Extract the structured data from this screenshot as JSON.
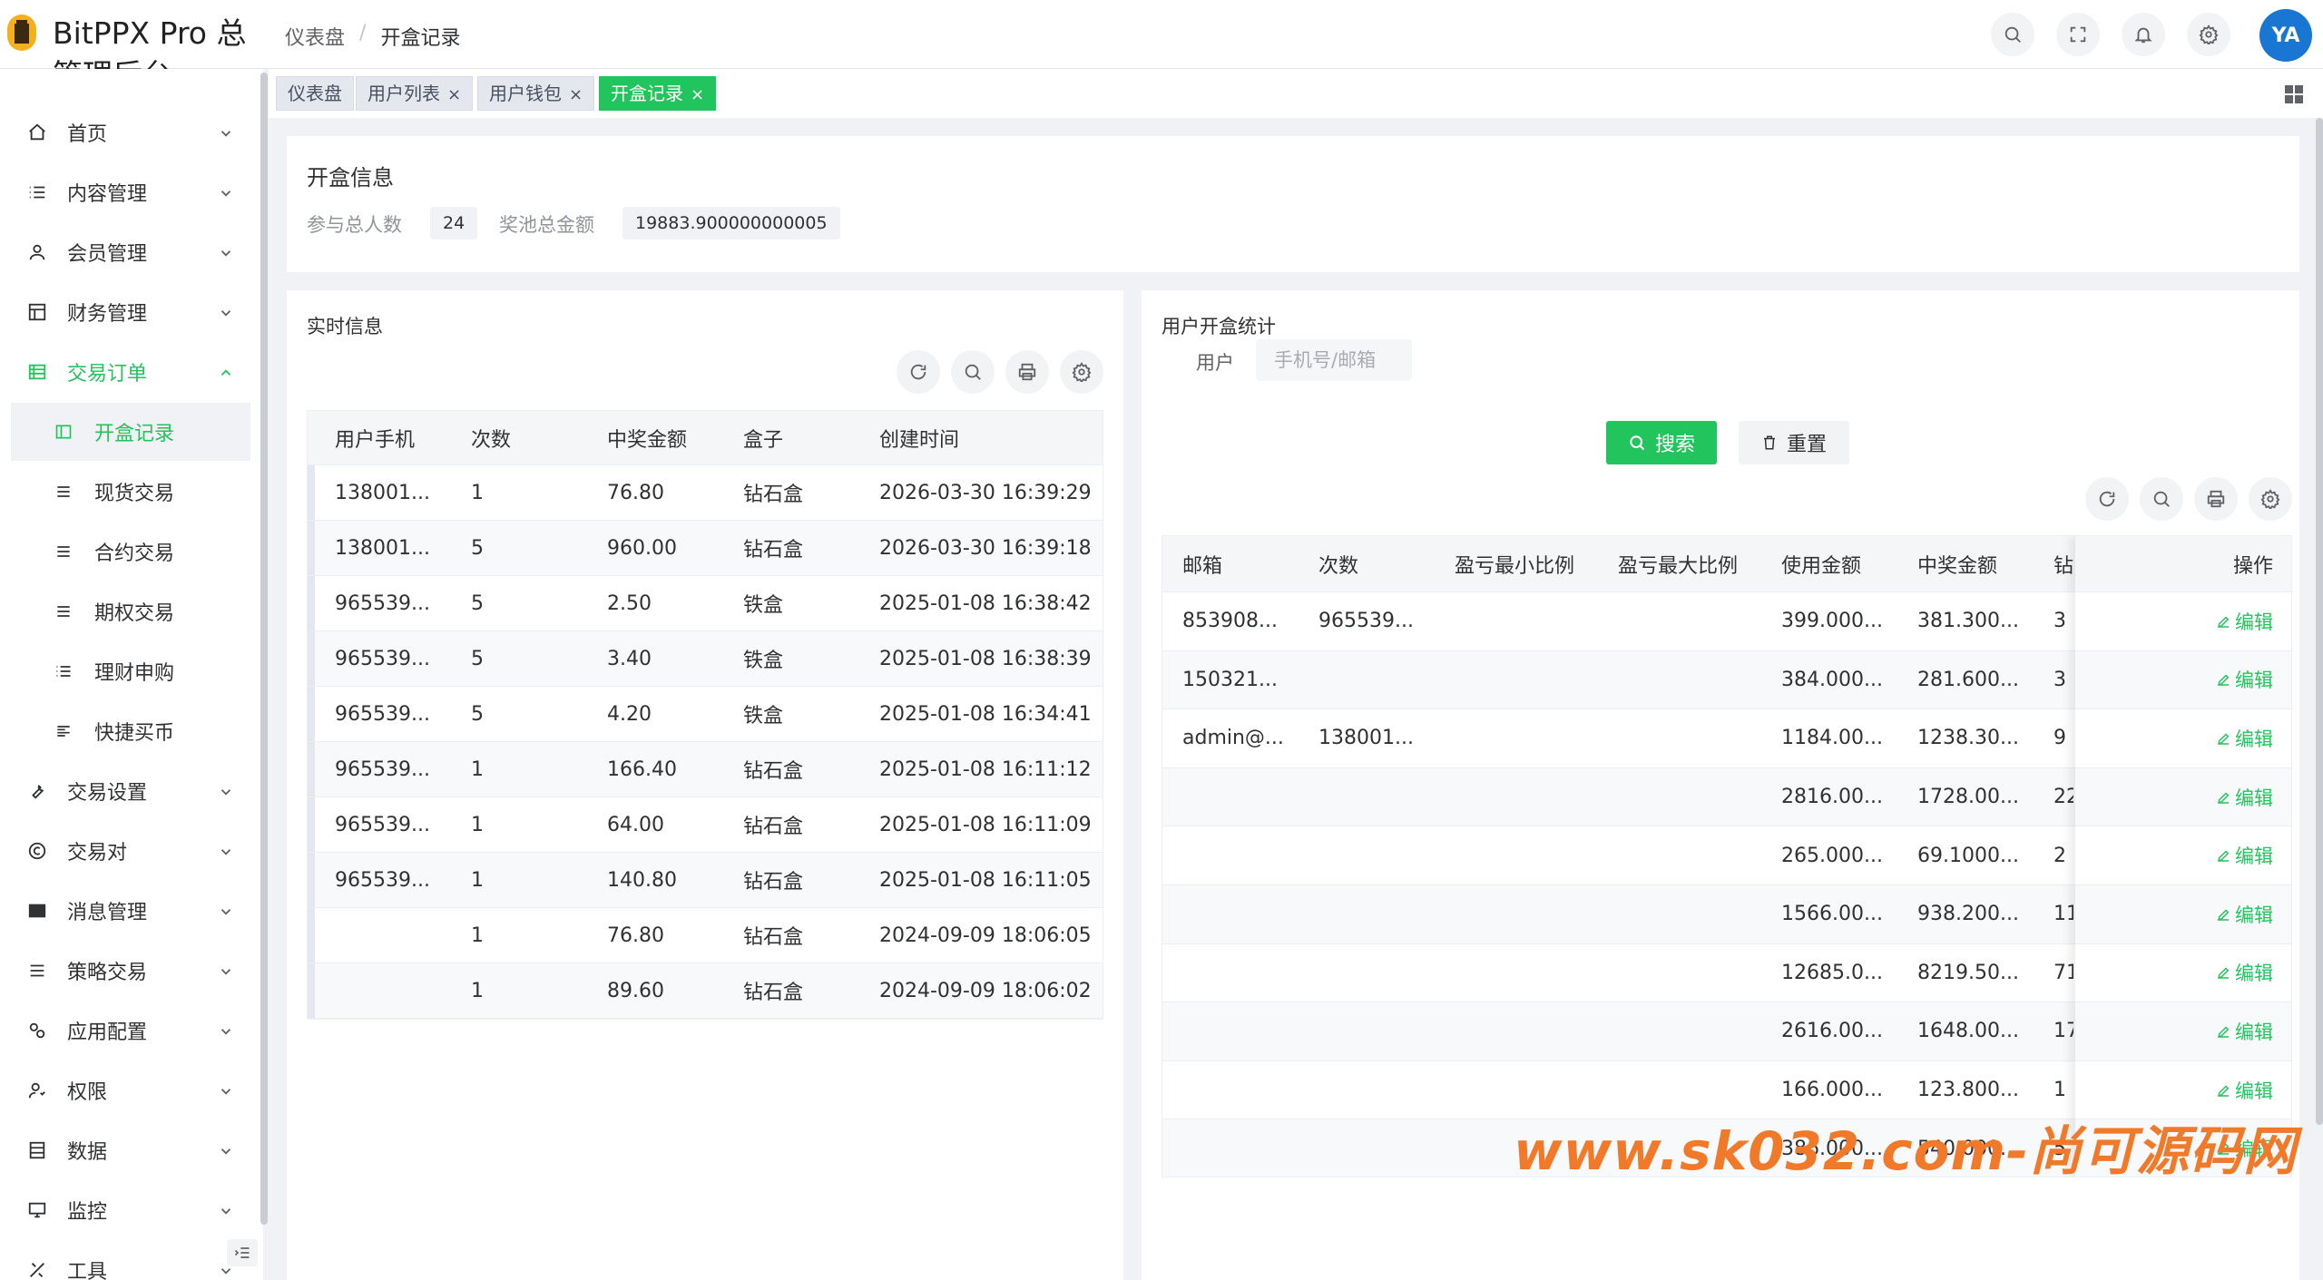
{
  "header": {
    "app_title": "BitPPX Pro 总管理后台",
    "breadcrumb": [
      "仪表盘",
      "开盒记录"
    ],
    "breadcrumb_sep": "/",
    "avatar_text": "YA"
  },
  "sidebar": {
    "menus": [
      {
        "label": "首页",
        "icon": "home-icon"
      },
      {
        "label": "内容管理",
        "icon": "list-icon"
      },
      {
        "label": "会员管理",
        "icon": "user-icon"
      },
      {
        "label": "财务管理",
        "icon": "table-icon"
      },
      {
        "label": "交易订单",
        "icon": "order-icon",
        "expanded": true
      },
      {
        "label": "交易设置",
        "icon": "wrench-icon"
      },
      {
        "label": "交易对",
        "icon": "copyright-icon"
      },
      {
        "label": "消息管理",
        "icon": "message-icon"
      },
      {
        "label": "策略交易",
        "icon": "menu-icon"
      },
      {
        "label": "应用配置",
        "icon": "config-icon"
      },
      {
        "label": "权限",
        "icon": "permission-icon"
      },
      {
        "label": "数据",
        "icon": "database-icon"
      },
      {
        "label": "监控",
        "icon": "monitor-icon"
      },
      {
        "label": "工具",
        "icon": "tool-icon"
      }
    ],
    "submenus": [
      {
        "label": "开盒记录",
        "active": true
      },
      {
        "label": "现货交易"
      },
      {
        "label": "合约交易"
      },
      {
        "label": "期权交易"
      },
      {
        "label": "理财申购"
      },
      {
        "label": "快捷买币"
      }
    ]
  },
  "tabs": [
    {
      "label": "仪表盘",
      "closable": false
    },
    {
      "label": "用户列表",
      "closable": true
    },
    {
      "label": "用户钱包",
      "closable": true
    },
    {
      "label": "开盒记录",
      "closable": true,
      "active": true
    }
  ],
  "tab_close_glyph": "×",
  "summary": {
    "title": "开盒信息",
    "participants_label": "参与总人数",
    "participants_value": "24",
    "pool_label": "奖池总金额",
    "pool_value": "19883.900000000005"
  },
  "realtime": {
    "title": "实时信息",
    "columns": [
      "用户手机",
      "次数",
      "中奖金额",
      "盒子",
      "创建时间"
    ],
    "rows": [
      [
        "138001...",
        "1",
        "76.80",
        "钻石盒",
        "2026-03-30 16:39:29"
      ],
      [
        "138001...",
        "5",
        "960.00",
        "钻石盒",
        "2026-03-30 16:39:18"
      ],
      [
        "965539...",
        "5",
        "2.50",
        "铁盒",
        "2025-01-08 16:38:42"
      ],
      [
        "965539...",
        "5",
        "3.40",
        "铁盒",
        "2025-01-08 16:38:39"
      ],
      [
        "965539...",
        "5",
        "4.20",
        "铁盒",
        "2025-01-08 16:34:41"
      ],
      [
        "965539...",
        "1",
        "166.40",
        "钻石盒",
        "2025-01-08 16:11:12"
      ],
      [
        "965539...",
        "1",
        "64.00",
        "钻石盒",
        "2025-01-08 16:11:09"
      ],
      [
        "965539...",
        "1",
        "140.80",
        "钻石盒",
        "2025-01-08 16:11:05"
      ],
      [
        "",
        "1",
        "76.80",
        "钻石盒",
        "2024-09-09 18:06:05"
      ],
      [
        "",
        "1",
        "89.60",
        "钻石盒",
        "2024-09-09 18:06:02"
      ]
    ]
  },
  "stats": {
    "title": "用户开盒统计",
    "user_label": "用户",
    "user_placeholder": "手机号/邮箱",
    "search_label": "搜索",
    "reset_label": "重置",
    "columns": [
      "邮箱",
      "次数",
      "盈亏最小比例",
      "盈亏最大比例",
      "使用金额",
      "中奖金额",
      "钻"
    ],
    "action_header": "操作",
    "edit_label": "编辑",
    "rows": [
      [
        "853908...",
        "965539...",
        "",
        "",
        "399.000...",
        "381.300...",
        "3"
      ],
      [
        "150321...",
        "",
        "",
        "",
        "384.000...",
        "281.600...",
        "3"
      ],
      [
        "admin@...",
        "138001...",
        "",
        "",
        "1184.00...",
        "1238.30...",
        "9"
      ],
      [
        "",
        "",
        "",
        "",
        "2816.00...",
        "1728.00...",
        "22"
      ],
      [
        "",
        "",
        "",
        "",
        "265.000...",
        "69.1000...",
        "2"
      ],
      [
        "",
        "",
        "",
        "",
        "1566.00...",
        "938.200...",
        "11"
      ],
      [
        "",
        "",
        "",
        "",
        "12685.0...",
        "8219.50...",
        "71"
      ],
      [
        "",
        "",
        "",
        "",
        "2616.00...",
        "1648.00...",
        "17"
      ],
      [
        "",
        "",
        "",
        "",
        "166.000...",
        "123.800...",
        "1"
      ],
      [
        "",
        "",
        "",
        "",
        "386.000...",
        "540.000...",
        "5"
      ]
    ]
  },
  "watermark": "www.sk032.com-尚可源码网",
  "colors": {
    "primary": "#21c45d",
    "watermark": "#f07a2a"
  }
}
